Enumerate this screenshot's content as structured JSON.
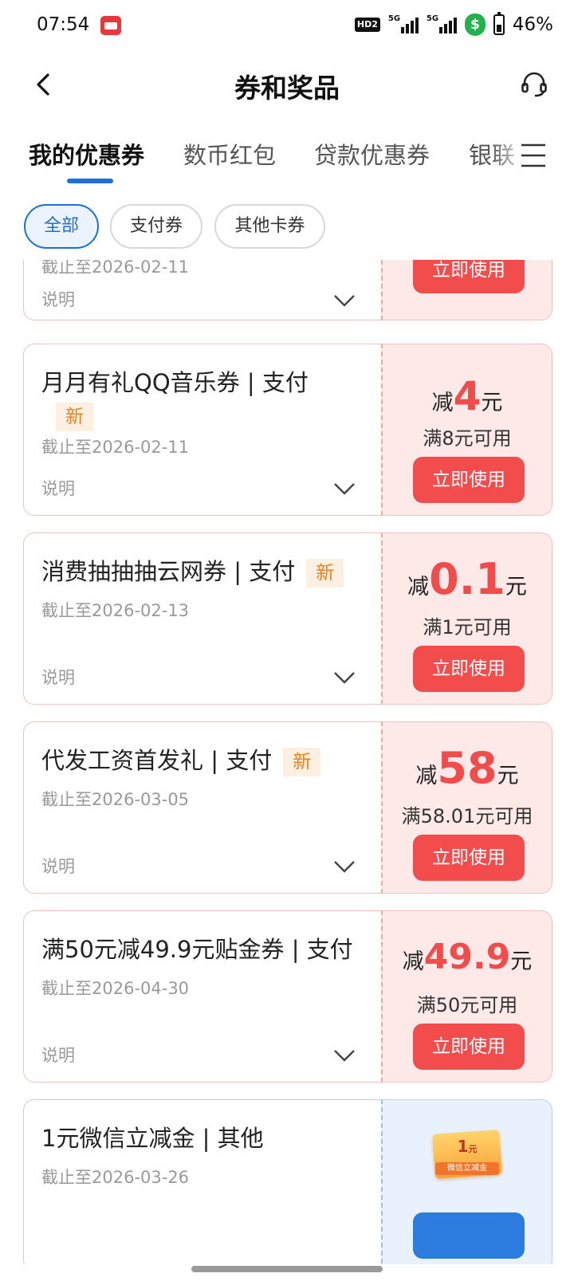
{
  "status_bar": {
    "time": "07:54",
    "hd": "HD2",
    "network_1": "5G",
    "network_2": "5G",
    "battery": "46%"
  },
  "header": {
    "title": "券和奖品"
  },
  "tabs": [
    {
      "label": "我的优惠券",
      "active": true
    },
    {
      "label": "数币红包",
      "active": false
    },
    {
      "label": "贷款优惠券",
      "active": false
    },
    {
      "label": "银联",
      "active": false
    }
  ],
  "filters": [
    {
      "label": "全部",
      "active": true
    },
    {
      "label": "支付券",
      "active": false
    },
    {
      "label": "其他卡券",
      "active": false
    }
  ],
  "coupons": [
    {
      "title": "",
      "new": false,
      "expiry": "截止至2026-02-11",
      "desc": "说明",
      "amount_prefix": "",
      "amount_value": "",
      "amount_suffix": "",
      "threshold": "",
      "button": "立即使用"
    },
    {
      "title": "月月有礼QQ音乐券 | 支付",
      "new": true,
      "new_label": "新",
      "expiry": "截止至2026-02-11",
      "desc": "说明",
      "amount_prefix": "减",
      "amount_value": "4",
      "amount_suffix": "元",
      "threshold": "满8元可用",
      "button": "立即使用"
    },
    {
      "title": "消费抽抽抽云网券 | 支付",
      "new": true,
      "new_label": "新",
      "expiry": "截止至2026-02-13",
      "desc": "说明",
      "amount_prefix": "减",
      "amount_value": "0.1",
      "amount_suffix": "元",
      "threshold": "满1元可用",
      "button": "立即使用"
    },
    {
      "title": "代发工资首发礼 | 支付",
      "new": true,
      "new_label": "新",
      "expiry": "截止至2026-03-05",
      "desc": "说明",
      "amount_prefix": "减",
      "amount_value": "58",
      "amount_suffix": "元",
      "threshold": "满58.01元可用",
      "button": "立即使用"
    },
    {
      "title": "满50元减49.9元贴金券 | 支付",
      "new": false,
      "expiry": "截止至2026-04-30",
      "desc": "说明",
      "amount_prefix": "减",
      "amount_value": "49.9",
      "amount_suffix": "元",
      "threshold": "满50元可用",
      "button": "立即使用"
    },
    {
      "title": "1元微信立减金 |  其他",
      "new": false,
      "expiry": "截止至2026-03-26",
      "prize_value": "1",
      "prize_unit": "元",
      "prize_label": "微信立减金"
    }
  ],
  "colors": {
    "accent_blue": "#1e6fd9",
    "coupon_red": "#f24c4c",
    "badge_orange": "#f07f1b"
  }
}
